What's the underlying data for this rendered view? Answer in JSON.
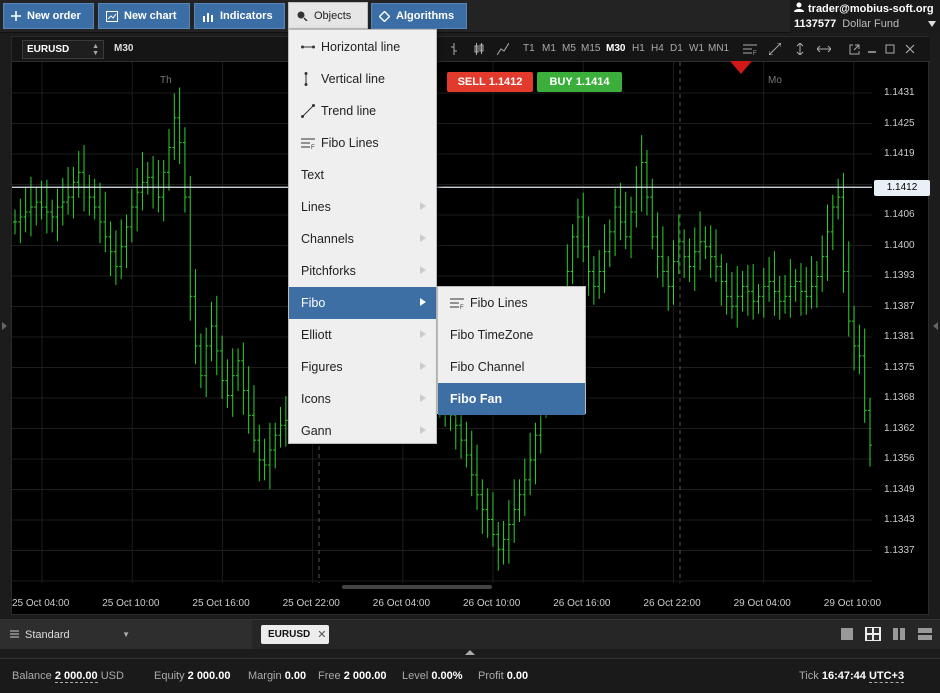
{
  "toolbar": {
    "new_order": "New order",
    "new_chart": "New chart",
    "indicators": "Indicators",
    "objects": "Objects",
    "algorithms": "Algorithms"
  },
  "account": {
    "email": "trader@mobius-soft.org",
    "number": "1137577",
    "fund": "Dollar Fund"
  },
  "chart": {
    "symbol": "EURUSD",
    "timeframe": "M30",
    "timeframes": [
      "T1",
      "M1",
      "M5",
      "M15",
      "M30",
      "H1",
      "H4",
      "D1",
      "W1",
      "MN1"
    ],
    "active_timeframe": "M30",
    "sell_label": "SELL",
    "sell_price": "1.1412",
    "buy_label": "BUY",
    "buy_price": "1.1414",
    "current_price_label": "1.1412",
    "day_labels": [
      "Th",
      "Mo"
    ],
    "price_labels": [
      "1.1431",
      "1.1425",
      "1.1419",
      "1.1406",
      "1.1400",
      "1.1393",
      "1.1387",
      "1.1381",
      "1.1375",
      "1.1368",
      "1.1362",
      "1.1356",
      "1.1349",
      "1.1343",
      "1.1337"
    ],
    "time_labels": [
      "25 Oct 04:00",
      "25 Oct 10:00",
      "25 Oct 16:00",
      "25 Oct 22:00",
      "26 Oct 04:00",
      "26 Oct 10:00",
      "26 Oct 16:00",
      "26 Oct 22:00",
      "29 Oct 04:00",
      "29 Oct 10:00"
    ],
    "colors": {
      "candle": "#2fd12f",
      "sell": "#e23b2e",
      "buy": "#3cae3c",
      "accent": "#3d6ea4"
    }
  },
  "objects_menu": {
    "items": [
      {
        "label": "Horizontal line",
        "icon": "horizontal-line-icon",
        "submenu": false
      },
      {
        "label": "Vertical line",
        "icon": "vertical-line-icon",
        "submenu": false
      },
      {
        "label": "Trend line",
        "icon": "trend-line-icon",
        "submenu": false
      },
      {
        "label": "Fibo Lines",
        "icon": "fibo-lines-icon",
        "submenu": false
      },
      {
        "label": "Text",
        "icon": "",
        "submenu": false
      },
      {
        "label": "Lines",
        "icon": "",
        "submenu": true
      },
      {
        "label": "Channels",
        "icon": "",
        "submenu": true
      },
      {
        "label": "Pitchforks",
        "icon": "",
        "submenu": true
      },
      {
        "label": "Fibo",
        "icon": "",
        "submenu": true
      },
      {
        "label": "Elliott",
        "icon": "",
        "submenu": true
      },
      {
        "label": "Figures",
        "icon": "",
        "submenu": true
      },
      {
        "label": "Icons",
        "icon": "",
        "submenu": true
      },
      {
        "label": "Gann",
        "icon": "",
        "submenu": true
      }
    ],
    "selected": "Fibo"
  },
  "fibo_menu": {
    "items": [
      "Fibo Lines",
      "Fibo TimeZone",
      "Fibo Channel",
      "Fibo Fan"
    ],
    "selected": "Fibo Fan"
  },
  "tabs": {
    "layout_name": "Standard",
    "symbol_tab": "EURUSD"
  },
  "status": {
    "balance_label": "Balance",
    "balance_value": "2 000.00",
    "balance_currency": "USD",
    "equity_label": "Equity",
    "equity_value": "2 000.00",
    "margin_label": "Margin",
    "margin_value": "0.00",
    "free_label": "Free",
    "free_value": "2 000.00",
    "level_label": "Level",
    "level_value": "0.00%",
    "profit_label": "Profit",
    "profit_value": "0.00",
    "tick_label": "Tick",
    "tick_time": "16:47:44",
    "timezone": "UTC+3"
  }
}
